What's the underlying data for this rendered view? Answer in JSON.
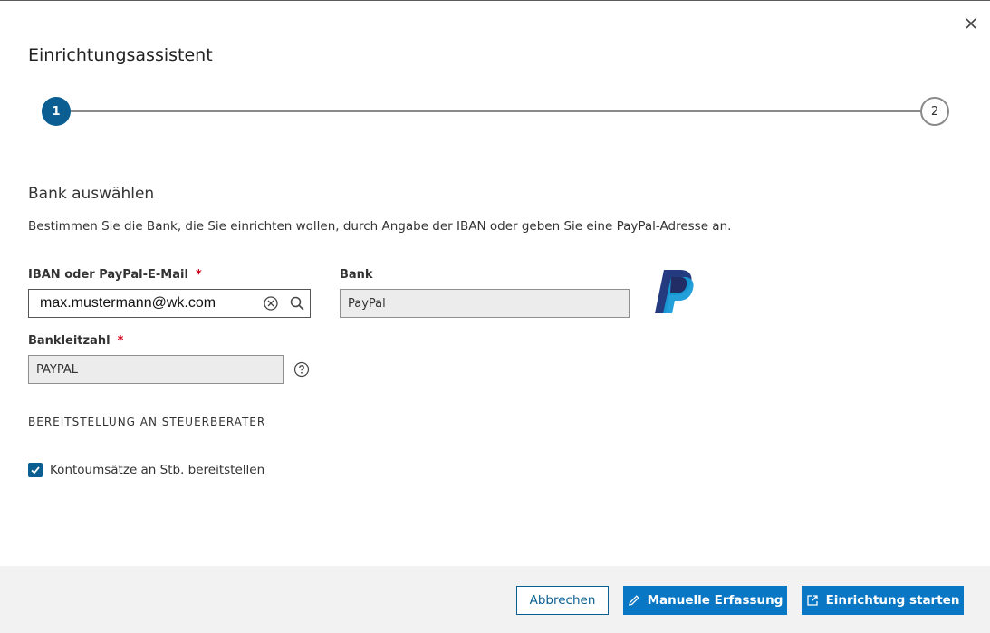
{
  "dialog": {
    "title": "Einrichtungsassistent",
    "close_icon": "close-icon"
  },
  "stepper": {
    "steps": [
      {
        "number": "1",
        "state": "active"
      },
      {
        "number": "2",
        "state": "inactive"
      }
    ]
  },
  "section": {
    "heading": "Bank auswählen",
    "description": "Bestimmen Sie die Bank, die Sie einrichten wollen, durch Angabe der IBAN oder geben Sie eine PayPal-Adresse an."
  },
  "form": {
    "iban": {
      "label": "IBAN oder PayPal-E-Mail",
      "required_mark": "*",
      "value": "max.mustermann@wk.com"
    },
    "bank": {
      "label": "Bank",
      "value": "PayPal"
    },
    "blz": {
      "label": "Bankleitzahl",
      "required_mark": "*",
      "value": "PAYPAL"
    }
  },
  "provision": {
    "heading": "BEREITSTELLUNG AN STEUERBERATER",
    "checkbox_label": "Kontoumsätze an Stb. bereitstellen",
    "checked": true
  },
  "footer": {
    "cancel_label": "Abbrechen",
    "manual_label": "Manuelle Erfassung",
    "start_label": "Einrichtung starten"
  },
  "colors": {
    "primary": "#0a77c4",
    "dark_primary": "#0a5e91",
    "required": "#d0021b",
    "paypal_dark": "#253b80",
    "paypal_light": "#179bd7"
  }
}
